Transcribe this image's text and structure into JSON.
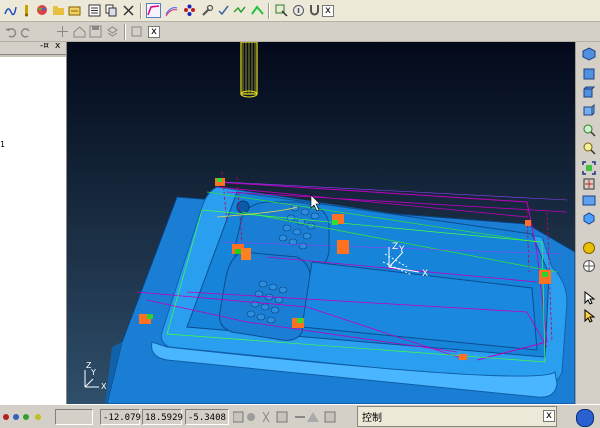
{
  "toolbar1": {
    "icons": [
      "toolpath-icon",
      "tool-icon",
      "paint-icon",
      "folder-icon",
      "open-icon",
      "list-icon",
      "copy-icon",
      "delete-icon",
      "curve-icon",
      "surface-icon",
      "points-icon",
      "wrench-icon",
      "check-icon",
      "green-path-icon",
      "zoom-select-icon",
      "info-icon",
      "magnet-icon"
    ],
    "close_label": "x"
  },
  "toolbar2": {
    "icons": [
      "undo-icon",
      "redo-icon",
      "pan-icon",
      "home-icon",
      "save-icon",
      "box-icon"
    ],
    "close_label": "x"
  },
  "left_panel": {
    "pin_label": "-¤",
    "close_label": "x",
    "marker": "1"
  },
  "viewport": {
    "background_top": "#03091a",
    "background_bottom": "#2f4f6a",
    "block_color": "#1e90e6",
    "toolpath_color": "#c000c0",
    "workplane_label_z": "Z",
    "workplane_label_y": "Y",
    "workplane_label_x": "X",
    "axis_label_z": "Z",
    "axis_label_y": "Y",
    "axis_label_x": "X"
  },
  "statusbar": {
    "coord_x": "-12.079",
    "coord_y": "18.5929",
    "coord_z": "-5.3408"
  },
  "control_panel": {
    "title": "控制",
    "close_label": "x"
  }
}
